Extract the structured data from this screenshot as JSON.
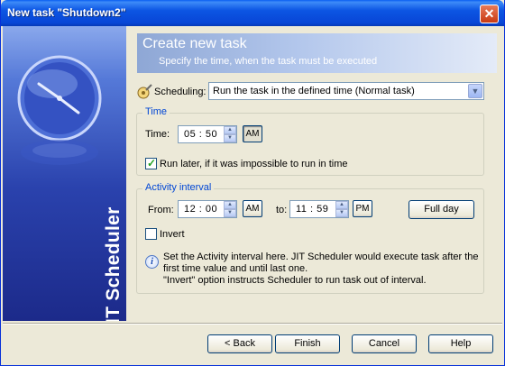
{
  "window": {
    "title": "New task \"Shutdown2\"",
    "close_glyph": "✕"
  },
  "banner": {
    "text": "JIT Scheduler",
    "icon": "clock-icon"
  },
  "header": {
    "title": "Create new task",
    "subtitle": "Specify the time, when the task must be executed"
  },
  "scheduling": {
    "label": "Scheduling:",
    "value": "Run the task in the defined time (Normal task)"
  },
  "time_group": {
    "title": "Time",
    "time_label": "Time:",
    "time_value": "05 : 50",
    "ampm": "AM",
    "run_later_label": "Run later, if it was impossible to run in time",
    "run_later_checked": true
  },
  "activity_group": {
    "title": "Activity interval",
    "from_label": "From:",
    "from_value": "12 : 00",
    "from_ampm": "AM",
    "to_label": "to:",
    "to_value": "11 : 59",
    "to_ampm": "PM",
    "full_day_label": "Full day",
    "invert_label": "Invert",
    "invert_checked": false
  },
  "info": {
    "line1": "Set the Activity interval here. JIT Scheduler would execute task after the",
    "line2": "first time value and until last one.",
    "line3": "\"Invert\" option instructs Scheduler to run task out of interval."
  },
  "buttons": {
    "back": "< Back",
    "finish": "Finish",
    "cancel": "Cancel",
    "help": "Help"
  }
}
